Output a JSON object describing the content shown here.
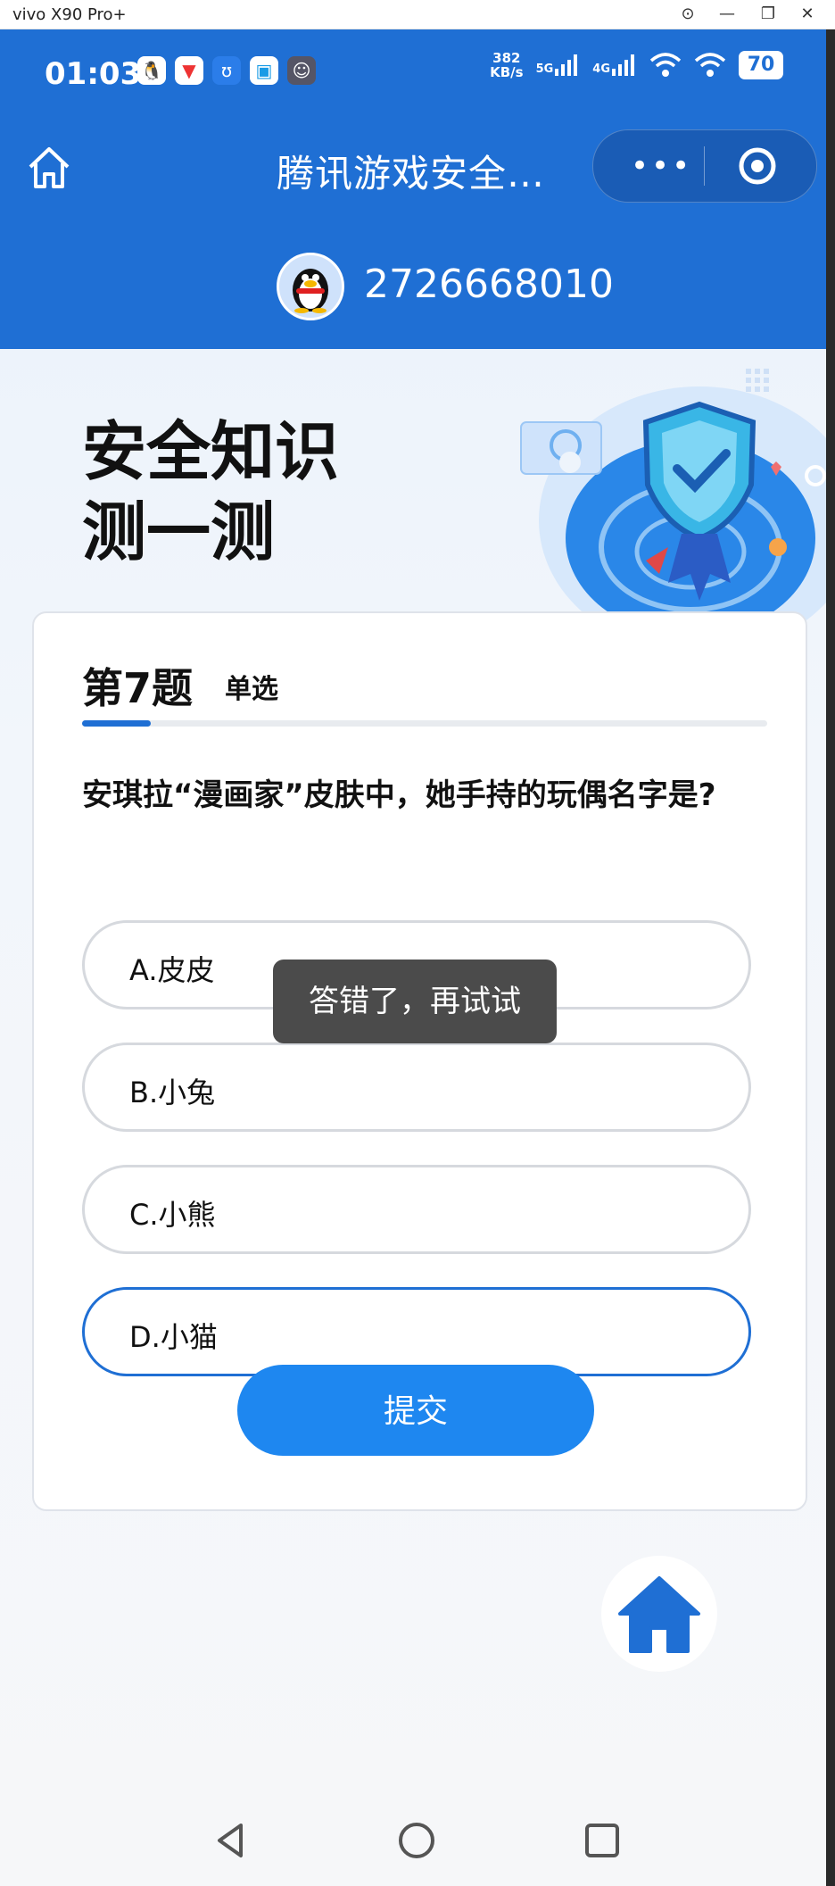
{
  "window": {
    "title": "vivo X90 Pro+",
    "controls": [
      "⊙",
      "—",
      "❐",
      "✕"
    ]
  },
  "status_bar": {
    "time": "01:03",
    "net_speed_value": "382",
    "net_speed_unit": "KB/s",
    "sim1": "5G",
    "sim2": "4G",
    "battery": "70"
  },
  "nav": {
    "title": "腾讯游戏安全…"
  },
  "user": {
    "qq_number": "2726668010"
  },
  "hero": {
    "line1": "安全知识",
    "line2": "测一测"
  },
  "quiz": {
    "question_number": "第7题",
    "question_type": "单选",
    "progress": 0.1,
    "question": "安琪拉“漫画家”皮肤中，她手持的玩偶名字是?",
    "options": [
      {
        "label": "A.皮皮",
        "selected": false
      },
      {
        "label": "B.小兔",
        "selected": false
      },
      {
        "label": "C.小熊",
        "selected": false
      },
      {
        "label": "D.小猫",
        "selected": true
      }
    ],
    "submit_label": "提交"
  },
  "toast": {
    "message": "答错了，再试试"
  },
  "colors": {
    "header_blue": "#1f6fd4",
    "submit_blue": "#1e87f0",
    "selected_border": "#1f6fd4"
  }
}
